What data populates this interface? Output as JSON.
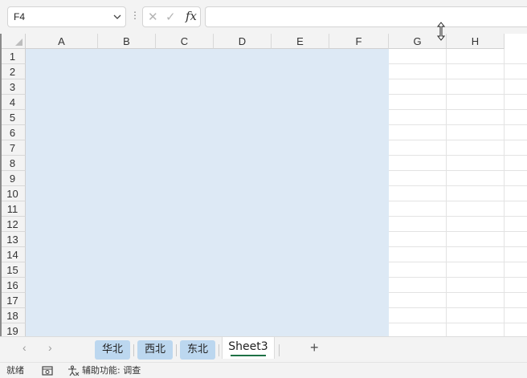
{
  "formula_bar": {
    "name_box_value": "F4",
    "name_box_arrow": "⌄",
    "dots": "⋮",
    "cancel_glyph": "✕",
    "enter_glyph": "✓",
    "fx_label": "fx",
    "formula_value": ""
  },
  "columns": [
    "A",
    "B",
    "C",
    "D",
    "E",
    "F",
    "G",
    "H"
  ],
  "rows": [
    "1",
    "2",
    "3",
    "4",
    "5",
    "6",
    "7",
    "8",
    "9",
    "10",
    "11",
    "12",
    "13",
    "14",
    "15",
    "16",
    "17",
    "18",
    "19"
  ],
  "selection": {
    "range_fill": "#dde9f5"
  },
  "tabs": {
    "prev_arrow": "‹",
    "next_arrow": "›",
    "sheets": [
      {
        "label": "华北",
        "color": "#bcd7ef"
      },
      {
        "label": "西北",
        "color": "#bcd7ef"
      },
      {
        "label": "东北",
        "color": "#bcd7ef"
      },
      {
        "label": "Sheet3",
        "active": true
      }
    ],
    "add_label": "+"
  },
  "status": {
    "ready": "就绪",
    "accessibility": "辅助功能: 调查"
  },
  "colors": {
    "accent_green": "#1e7145",
    "header_bg": "#f3f3f3"
  }
}
